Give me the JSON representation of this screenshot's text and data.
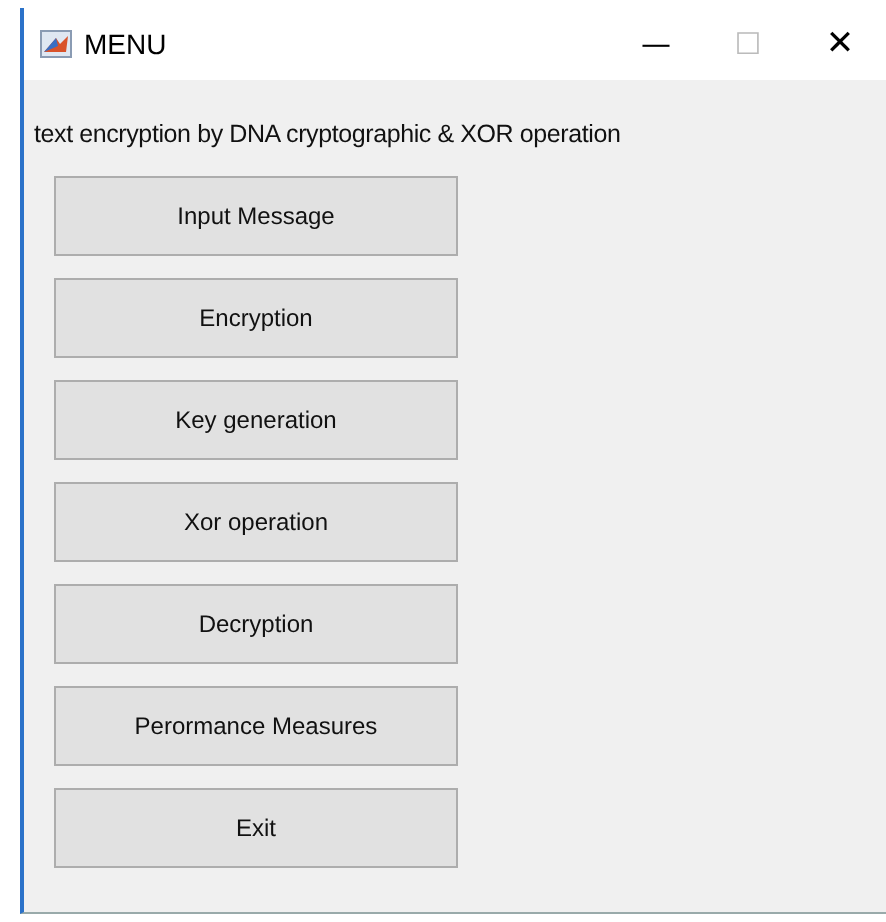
{
  "window": {
    "title": "MENU",
    "controls": [
      "—",
      "☐",
      "✕"
    ]
  },
  "heading": "text encryption by DNA cryptographic & XOR operation",
  "buttons": [
    "Input Message",
    "Encryption",
    "Key generation",
    "Xor operation",
    "Decryption",
    "Perormance Measures",
    "Exit"
  ]
}
